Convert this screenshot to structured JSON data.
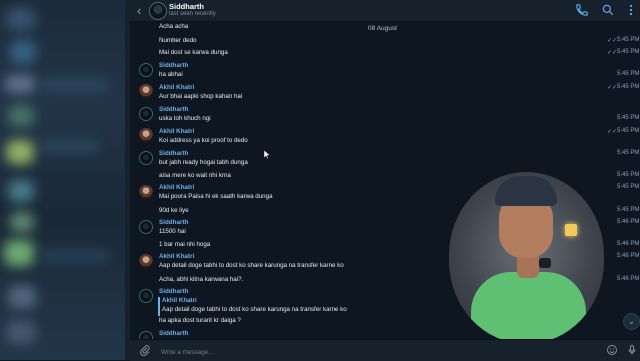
{
  "header": {
    "name": "Siddharth",
    "status": "last seen recently"
  },
  "date_separator": "08 August",
  "messages": [
    {
      "sender": "",
      "text": "Acha acha",
      "time": "",
      "ticks": ""
    },
    {
      "sender": "",
      "text": "Number dedo",
      "time": "5:45 PM",
      "ticks": "✓✓"
    },
    {
      "sender": "",
      "text": "Mai dost se karwa dunga",
      "time": "5:45 PM",
      "ticks": "✓✓"
    },
    {
      "sender": "Siddharth",
      "text": "ha abhai",
      "time": "5:45 PM",
      "ticks": ""
    },
    {
      "sender": "Akhil Khatri",
      "text": "Aur bhai aapki shop kahan hai",
      "time": "5:45 PM",
      "ticks": "✓✓"
    },
    {
      "sender": "Siddharth",
      "text": "uska toh khuch ngi",
      "time": "5:45 PM",
      "ticks": ""
    },
    {
      "sender": "Akhil Khatri",
      "text": "Koi address ya koi proof to dedo",
      "time": "5:45 PM",
      "ticks": "✓✓"
    },
    {
      "sender": "Siddharth",
      "text": "but jabh ready hogai tabh dunga",
      "time": "5:45 PM",
      "ticks": ""
    },
    {
      "sender": "",
      "text": "aisa mere ko wait nhi krna",
      "time": "5:45 PM",
      "ticks": ""
    },
    {
      "sender": "Akhil Khatri",
      "text": "Mai poora Paisa hi ek saath karwa dunga",
      "time": "5:45 PM",
      "ticks": ""
    },
    {
      "sender": "",
      "text": "90d ke liye",
      "time": "5:45 PM",
      "ticks": ""
    },
    {
      "sender": "Siddharth",
      "text": "11500 hai",
      "time": "5:46 PM",
      "ticks": ""
    },
    {
      "sender": "",
      "text": "1 bar mai nhi hoga",
      "time": "5:46 PM",
      "ticks": ""
    },
    {
      "sender": "Akhil Khatri",
      "text": "Aap detail doge tabhi to dost ko share karunga na transfer karne ko",
      "time": "5:46 PM",
      "ticks": ""
    },
    {
      "sender": "",
      "text": "Acha, abhi kitna karwana hai?.",
      "time": "5:46 PM",
      "ticks": ""
    }
  ],
  "reply_message": {
    "sender": "Siddharth",
    "quoted_name": "Akhil Khatri",
    "quoted_text": "Aap detail doge tabhi to dost ko share karunga na transfer karne ko",
    "text": "ha apka dost turant kr daiga ?"
  },
  "last_sender": "Siddharth",
  "input": {
    "placeholder": "Write a message..."
  },
  "icons": [
    "back-arrow-icon",
    "phone-icon",
    "search-icon",
    "more-icon",
    "attach-icon",
    "emoji-icon",
    "microphone-icon",
    "chevron-down-icon"
  ],
  "colors": {
    "accent": "#5fa6e6",
    "background": "#0e1621",
    "panel": "#17212b",
    "sender": "#6fb0e8"
  }
}
